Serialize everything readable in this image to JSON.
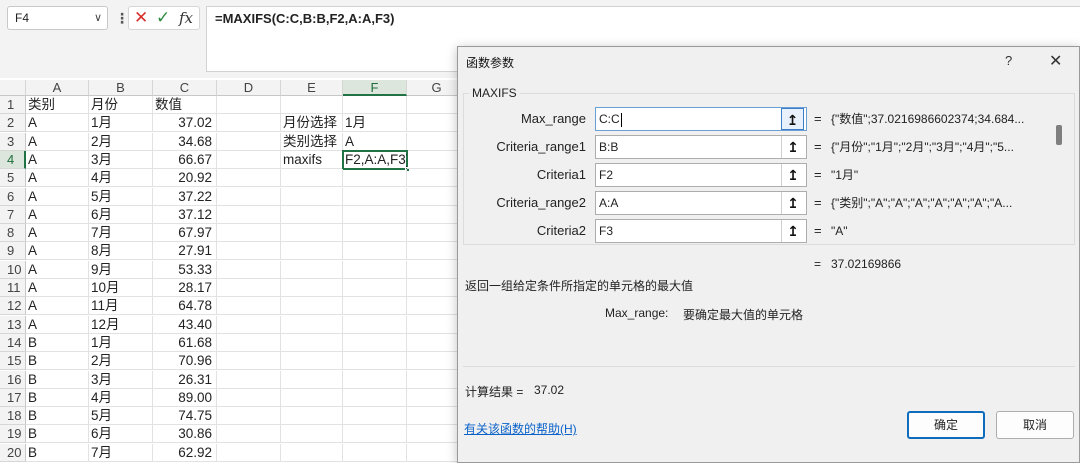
{
  "formula_bar": {
    "name_box": "F4",
    "name_box_dropdown": "∨",
    "separator": "⋮",
    "cancel_icon": "✕",
    "enter_icon": "✓",
    "insert_function_label": "fx",
    "formula": "=MAXIFS(C:C,B:B,F2,A:A,F3)"
  },
  "sheet": {
    "columns": [
      "A",
      "B",
      "C",
      "D",
      "E",
      "F",
      "G"
    ],
    "active_column": "F",
    "active_row": "4",
    "rows": [
      {
        "num": "1",
        "a": "类别",
        "b": "月份",
        "c": "数值",
        "e": "",
        "f": ""
      },
      {
        "num": "2",
        "a": "A",
        "b": "1月",
        "c": "37.02",
        "e": "月份选择",
        "f": "1月"
      },
      {
        "num": "3",
        "a": "A",
        "b": "2月",
        "c": "34.68",
        "e": "类别选择",
        "f": "A"
      },
      {
        "num": "4",
        "a": "A",
        "b": "3月",
        "c": "66.67",
        "e": "maxifs",
        "f": "F2,A:A,F3)"
      },
      {
        "num": "5",
        "a": "A",
        "b": "4月",
        "c": "20.92",
        "e": "",
        "f": ""
      },
      {
        "num": "6",
        "a": "A",
        "b": "5月",
        "c": "37.22",
        "e": "",
        "f": ""
      },
      {
        "num": "7",
        "a": "A",
        "b": "6月",
        "c": "37.12",
        "e": "",
        "f": ""
      },
      {
        "num": "8",
        "a": "A",
        "b": "7月",
        "c": "67.97",
        "e": "",
        "f": ""
      },
      {
        "num": "9",
        "a": "A",
        "b": "8月",
        "c": "27.91",
        "e": "",
        "f": ""
      },
      {
        "num": "10",
        "a": "A",
        "b": "9月",
        "c": "53.33",
        "e": "",
        "f": ""
      },
      {
        "num": "11",
        "a": "A",
        "b": "10月",
        "c": "28.17",
        "e": "",
        "f": ""
      },
      {
        "num": "12",
        "a": "A",
        "b": "11月",
        "c": "64.78",
        "e": "",
        "f": ""
      },
      {
        "num": "13",
        "a": "A",
        "b": "12月",
        "c": "43.40",
        "e": "",
        "f": ""
      },
      {
        "num": "14",
        "a": "B",
        "b": "1月",
        "c": "61.68",
        "e": "",
        "f": ""
      },
      {
        "num": "15",
        "a": "B",
        "b": "2月",
        "c": "70.96",
        "e": "",
        "f": ""
      },
      {
        "num": "16",
        "a": "B",
        "b": "3月",
        "c": "26.31",
        "e": "",
        "f": ""
      },
      {
        "num": "17",
        "a": "B",
        "b": "4月",
        "c": "89.00",
        "e": "",
        "f": ""
      },
      {
        "num": "18",
        "a": "B",
        "b": "5月",
        "c": "74.75",
        "e": "",
        "f": ""
      },
      {
        "num": "19",
        "a": "B",
        "b": "6月",
        "c": "30.86",
        "e": "",
        "f": ""
      },
      {
        "num": "20",
        "a": "B",
        "b": "7月",
        "c": "62.92",
        "e": "",
        "f": ""
      }
    ]
  },
  "dialog": {
    "title": "函数参数",
    "help_icon": "?",
    "close_icon": "✕",
    "function_name": "MAXIFS",
    "picker_icon": "↥",
    "args": [
      {
        "label": "Max_range",
        "input": "C:C",
        "value": "{\"数值\";37.0216986602374;34.684..."
      },
      {
        "label": "Criteria_range1",
        "input": "B:B",
        "value": "{\"月份\";\"1月\";\"2月\";\"3月\";\"4月\";\"5..."
      },
      {
        "label": "Criteria1",
        "input": "F2",
        "value": "\"1月\""
      },
      {
        "label": "Criteria_range2",
        "input": "A:A",
        "value": "{\"类别\";\"A\";\"A\";\"A\";\"A\";\"A\";\"A\";\"A..."
      },
      {
        "label": "Criteria2",
        "input": "F3",
        "value": "\"A\""
      }
    ],
    "equals": "=",
    "result_value": "37.02169866",
    "description": "返回一组给定条件所指定的单元格的最大值",
    "arg_desc_name": "Max_range:",
    "arg_desc_text": "要确定最大值的单元格",
    "calc_label": "计算结果 =",
    "calc_value": "37.02",
    "help_link": "有关该函数的帮助(H)",
    "ok": "确定",
    "cancel": "取消"
  },
  "colors": {
    "accent": "#217346",
    "link": "#0b62c9",
    "primary_button": "#0f6cbd"
  }
}
